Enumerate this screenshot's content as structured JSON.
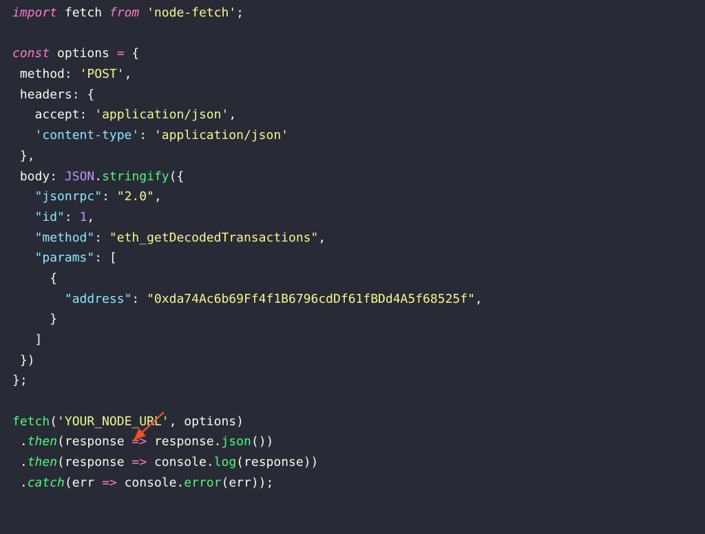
{
  "code": {
    "line1": {
      "kw_import": "import",
      "ident_fetch": " fetch ",
      "kw_from": "from",
      "space": " ",
      "str_module": "'node-fetch'",
      "semi": ";"
    },
    "line3": {
      "kw_const": "const",
      "ident": " options ",
      "equals": "=",
      "brace": " {"
    },
    "line4": {
      "indent": " ",
      "prop": "method",
      "colon": ": ",
      "str": "'POST'",
      "comma": ","
    },
    "line5": {
      "indent": " ",
      "prop": "headers",
      "colon": ": ",
      "brace": "{"
    },
    "line6": {
      "indent": "   ",
      "prop": "accept",
      "colon": ": ",
      "str": "'application/json'",
      "comma": ","
    },
    "line7": {
      "indent": "   ",
      "key": "'content-type'",
      "colon": ": ",
      "str": "'application/json'"
    },
    "line8": {
      "indent": " ",
      "brace": "}",
      "comma": ","
    },
    "line9": {
      "indent": " ",
      "prop": "body",
      "colon": ": ",
      "obj_json": "JSON",
      "dot": ".",
      "method": "stringify",
      "paren": "(",
      "brace": "{"
    },
    "line10": {
      "indent": "   ",
      "key": "\"jsonrpc\"",
      "colon": ": ",
      "str": "\"2.0\"",
      "comma": ","
    },
    "line11": {
      "indent": "   ",
      "key": "\"id\"",
      "colon": ": ",
      "num": "1",
      "comma": ","
    },
    "line12": {
      "indent": "   ",
      "key": "\"method\"",
      "colon": ": ",
      "str": "\"eth_getDecodedTransactions\"",
      "comma": ","
    },
    "line13": {
      "indent": "   ",
      "key": "\"params\"",
      "colon": ": ",
      "bracket": "["
    },
    "line14": {
      "indent": "     ",
      "brace": "{"
    },
    "line15": {
      "indent": "       ",
      "key": "\"address\"",
      "colon": ": ",
      "str": "\"0xda74Ac6b69Ff4f1B6796cdDf61fBDd4A5f68525f\"",
      "comma": ","
    },
    "line16": {
      "indent": "     ",
      "brace": "}"
    },
    "line17": {
      "indent": "   ",
      "bracket": "]"
    },
    "line18": {
      "indent": " ",
      "brace": "}",
      "paren": ")"
    },
    "line19": {
      "brace": "}",
      "semi": ";"
    },
    "line21": {
      "fn": "fetch",
      "paren1": "(",
      "str": "'YOUR_NODE_URL'",
      "comma": ", ",
      "ident": "options",
      "paren2": ")"
    },
    "line22": {
      "indent": " ",
      "dot": ".",
      "method": "then",
      "paren1": "(",
      "param": "response",
      "arrow": " => ",
      "ident": "response",
      "dot2": ".",
      "method2": "json",
      "parens": "())"
    },
    "line23": {
      "indent": " ",
      "dot": ".",
      "method": "then",
      "paren1": "(",
      "param": "response",
      "arrow": " => ",
      "ident": "console",
      "dot2": ".",
      "method2": "log",
      "paren2": "(",
      "arg": "response",
      "parens": "))"
    },
    "line24": {
      "indent": " ",
      "dot": ".",
      "method": "catch",
      "paren1": "(",
      "param": "err",
      "arrow": " => ",
      "ident": "console",
      "dot2": ".",
      "method2": "error",
      "paren2": "(",
      "arg": "err",
      "parens": "));"
    }
  },
  "colors": {
    "background": "#282a36",
    "keyword": "#ff79c6",
    "string": "#f1fa8c",
    "function": "#50fa7b",
    "number": "#bd93f9",
    "cyan": "#8be9fd",
    "text": "#f8f8f2",
    "arrow_annotation": "#f04e23"
  }
}
